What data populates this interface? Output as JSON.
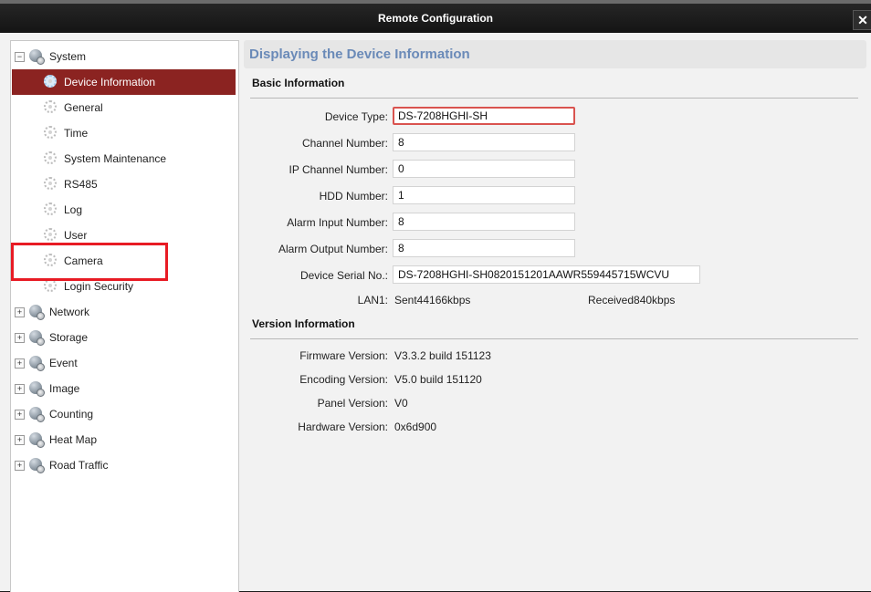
{
  "window": {
    "title": "Remote Configuration",
    "close_label": "✕"
  },
  "tree": {
    "system": {
      "label": "System",
      "expander": "−",
      "children": [
        "Device Information",
        "General",
        "Time",
        "System Maintenance",
        "RS485",
        "Log",
        "User",
        "Camera",
        "Login Security"
      ]
    },
    "groups": [
      {
        "label": "Network",
        "expander": "+"
      },
      {
        "label": "Storage",
        "expander": "+"
      },
      {
        "label": "Event",
        "expander": "+"
      },
      {
        "label": "Image",
        "expander": "+"
      },
      {
        "label": "Counting",
        "expander": "+"
      },
      {
        "label": "Heat Map",
        "expander": "+"
      },
      {
        "label": "Road Traffic",
        "expander": "+"
      }
    ],
    "selected": "Device Information",
    "highlighted": "User"
  },
  "page": {
    "title": "Displaying the Device Information",
    "basic": {
      "heading": "Basic Information",
      "fields": [
        {
          "label": "Device Type:",
          "value": "DS-7208HGHI-SH"
        },
        {
          "label": "Channel Number:",
          "value": "8"
        },
        {
          "label": "IP Channel Number:",
          "value": "0"
        },
        {
          "label": "HDD Number:",
          "value": "1"
        },
        {
          "label": "Alarm Input Number:",
          "value": "8"
        },
        {
          "label": "Alarm Output Number:",
          "value": "8"
        },
        {
          "label": "Device Serial No.:",
          "value": "DS-7208HGHI-SH0820151201AAWR559445715WCVU"
        }
      ],
      "lan": {
        "label": "LAN1:",
        "sent": "Sent44166kbps",
        "received": "Received840kbps"
      }
    },
    "version": {
      "heading": "Version Information",
      "rows": [
        {
          "label": "Firmware Version:",
          "value": "V3.3.2 build 151123"
        },
        {
          "label": "Encoding Version:",
          "value": "V5.0 build 151120"
        },
        {
          "label": "Panel Version:",
          "value": "V0"
        },
        {
          "label": "Hardware Version:",
          "value": "0x6d900"
        }
      ]
    }
  },
  "colors": {
    "selected_bg": "#8b2321",
    "title_blue": "#6a8ab8",
    "highlight_red": "#e81b24",
    "focus_border": "#d9534f"
  }
}
